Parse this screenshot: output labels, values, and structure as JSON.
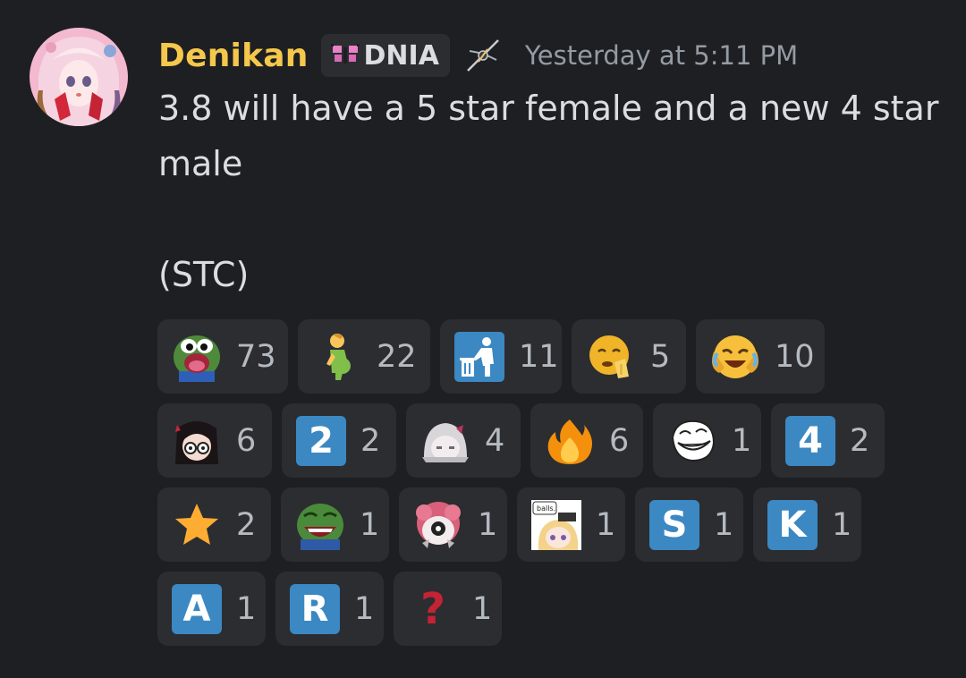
{
  "author": {
    "name": "Denikan",
    "tag": "DNIA",
    "timestamp": "Yesterday at 5:11 PM"
  },
  "message": {
    "text": "3.8 will have a 5 star female and a new 4 star\nmale\n\n(STC)"
  },
  "icons": {
    "avatar": "anime-girl-avatar",
    "tag_icon": "pink-butterfly-icon",
    "badge": "sword-badge-icon"
  },
  "reactions": [
    {
      "emoji": "pepe-shocked",
      "count": "73"
    },
    {
      "emoji": "pregnant-man",
      "count": "22"
    },
    {
      "emoji": "put-litter-in-bin",
      "count": "11"
    },
    {
      "emoji": "face-holding-back-tears",
      "count": "5"
    },
    {
      "emoji": "face-with-tears-of-joy-laughing",
      "count": "10"
    },
    {
      "emoji": "dark-hair-girl",
      "count": "6"
    },
    {
      "emoji": "keycap-2",
      "key": "2",
      "count": "2"
    },
    {
      "emoji": "grey-haired-anime",
      "count": "4"
    },
    {
      "emoji": "fire",
      "count": "6"
    },
    {
      "emoji": "troll-face",
      "count": "1"
    },
    {
      "emoji": "keycap-4",
      "key": "4",
      "count": "2"
    },
    {
      "emoji": "star",
      "count": "2"
    },
    {
      "emoji": "pepe-laughing",
      "count": "1"
    },
    {
      "emoji": "pink-hair-anime-eye",
      "count": "1"
    },
    {
      "emoji": "balls-sticker",
      "caption": "balls.",
      "count": "1"
    },
    {
      "emoji": "letter-s",
      "key": "S",
      "count": "1"
    },
    {
      "emoji": "letter-k",
      "key": "K",
      "count": "1"
    },
    {
      "emoji": "letter-a",
      "key": "A",
      "count": "1"
    },
    {
      "emoji": "letter-r",
      "key": "R",
      "count": "1"
    },
    {
      "emoji": "red-question-mark",
      "key": "?",
      "count": "1"
    }
  ],
  "colors": {
    "background": "#1e1f22",
    "username": "#f5c84c",
    "reaction_bg": "#2b2d31",
    "keycap_blue": "#3b88c3"
  }
}
